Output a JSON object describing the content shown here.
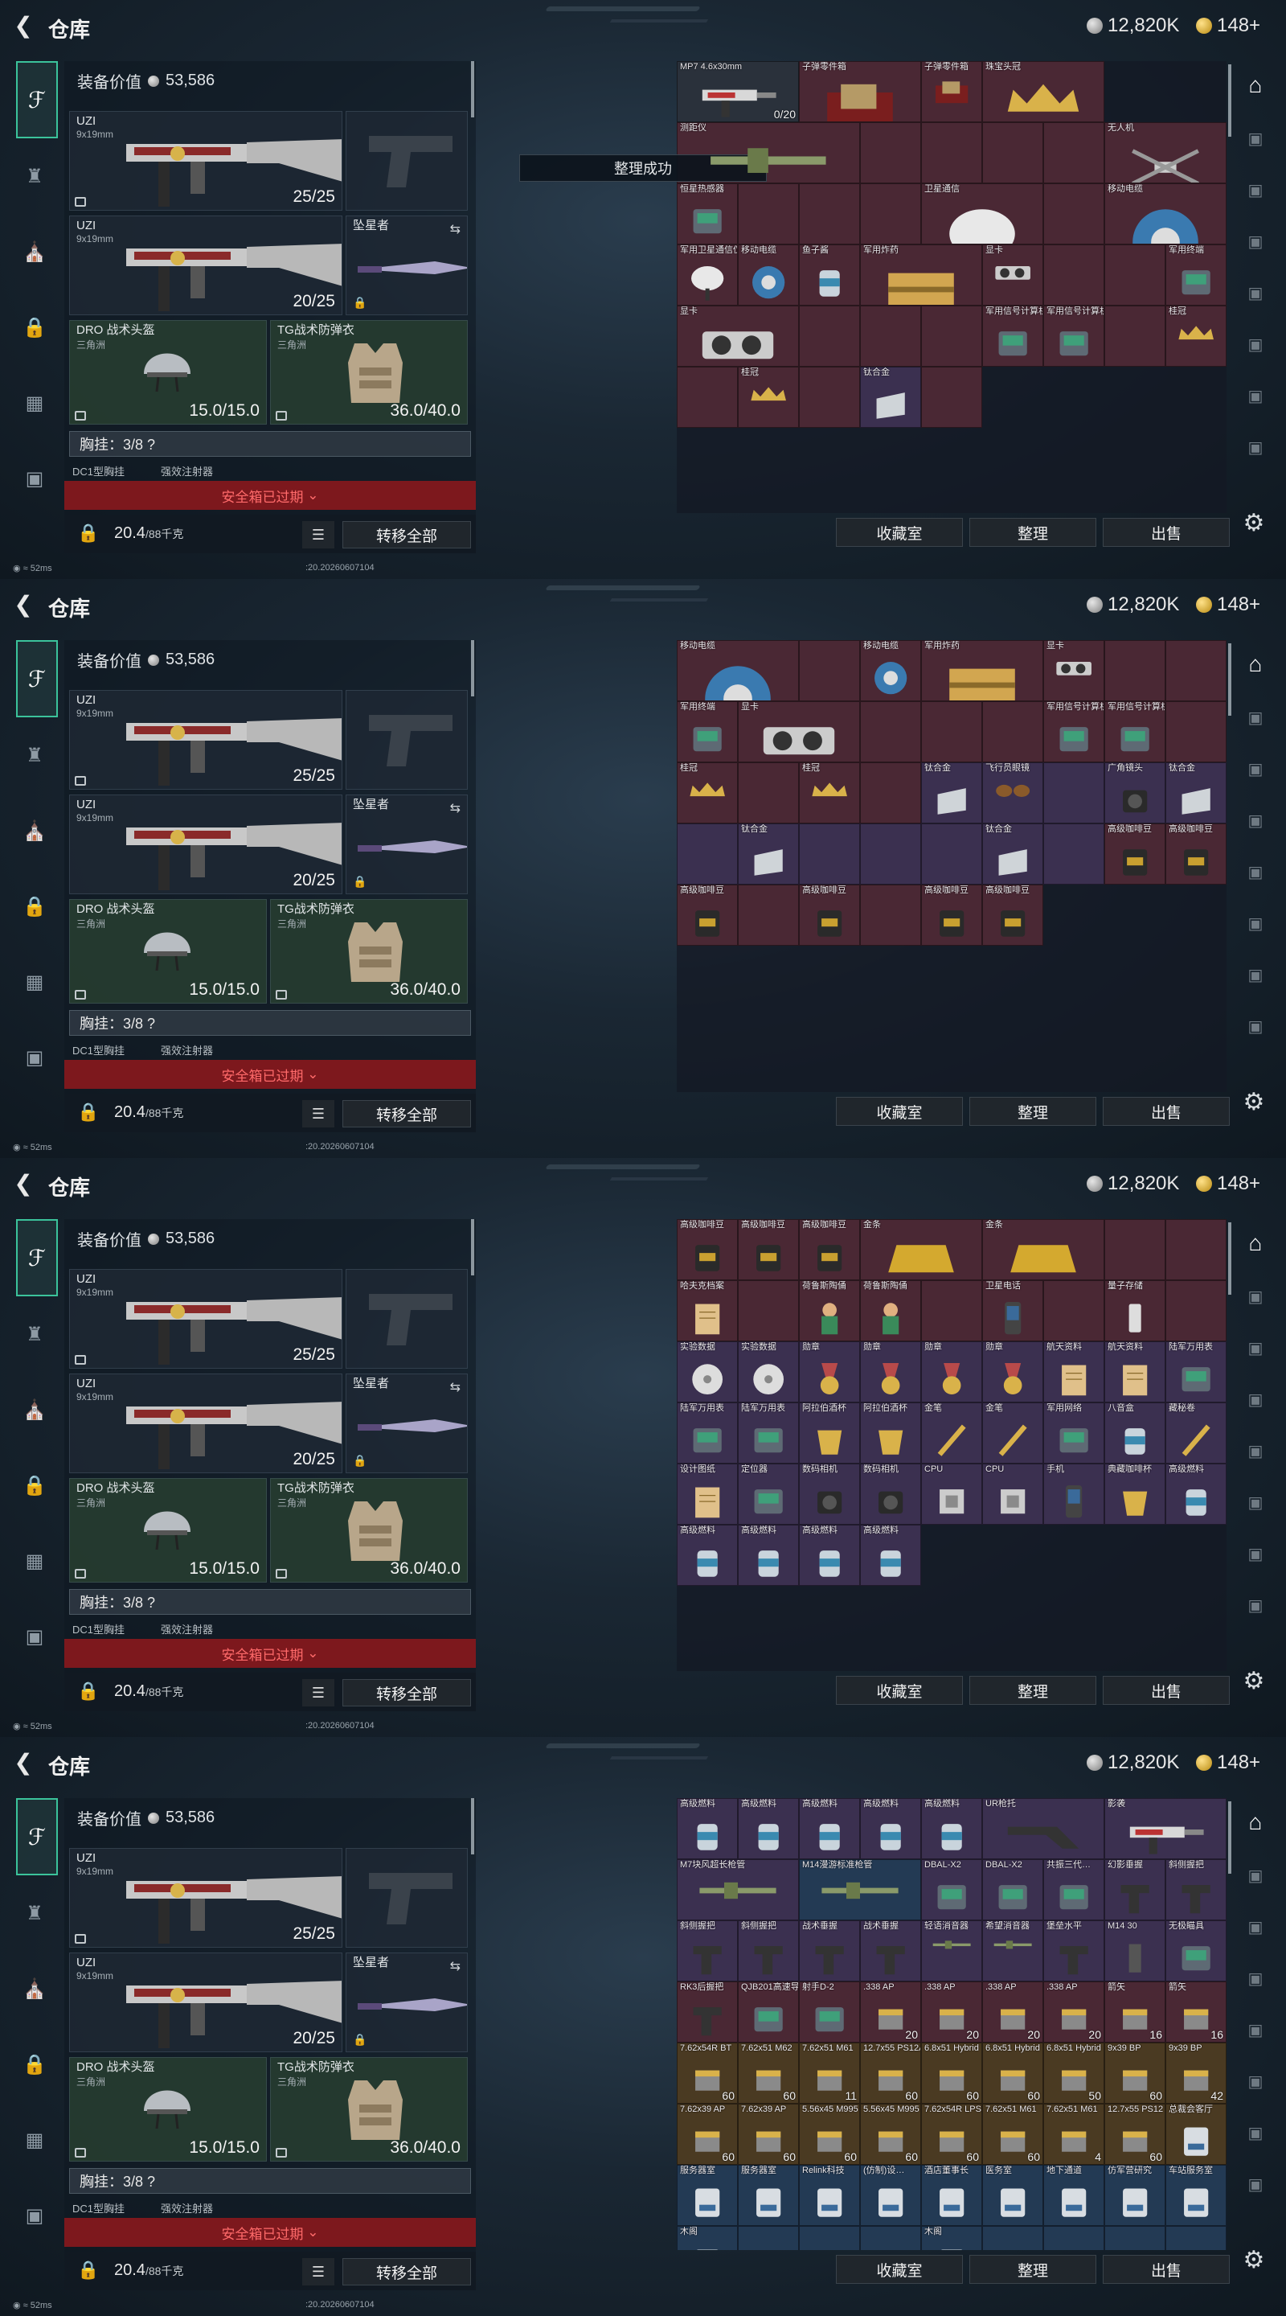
{
  "title": "仓库",
  "currency": {
    "silver": "12,820K",
    "gold": "148+"
  },
  "toast": "整理成功",
  "loadout": {
    "value_label": "装备价值",
    "value": "53,586",
    "primary": {
      "name": "UZI",
      "sub": "9x19mm",
      "count": "25/25"
    },
    "secondary": {
      "name": "UZI",
      "sub": "9x19mm",
      "count": "20/25"
    },
    "melee": {
      "name": "坠星者"
    },
    "helmet": {
      "name": "DRO 战术头盔",
      "sub": "三角洲",
      "count": "15.0/15.0"
    },
    "armor": {
      "name": "TG战术防弹衣",
      "sub": "三角洲",
      "count": "36.0/40.0"
    },
    "chest": "胸挂：3/8  ?",
    "chest_items": [
      "DC1型胸挂",
      "强效注射器"
    ],
    "safe_box": "安全箱已过期",
    "weight": "20.4",
    "weight_unit": "/88千克",
    "transfer_all": "转移全部"
  },
  "stash_buttons": {
    "collection": "收藏室",
    "sort": "整理",
    "sell": "出售"
  },
  "status": {
    "ping": "52ms",
    "build": ":20.20260607104"
  },
  "frames": [
    {
      "cells": [
        {
          "n": "MP7 4.6x30mm",
          "c": "gray",
          "q": "0/20",
          "i": "gun",
          "w": 2,
          "h": 1
        },
        {
          "n": "子弹零件箱",
          "c": "red",
          "i": "box",
          "w": 2,
          "h": 1
        },
        {
          "n": "子弹零件箱",
          "c": "red",
          "i": "box"
        },
        {
          "n": "珠宝头冠",
          "c": "red",
          "i": "crown",
          "w": 2
        },
        {
          "n": "测距仪",
          "c": "red",
          "i": "rod",
          "w": 3
        },
        {
          "n": "",
          "c": "red"
        },
        {
          "n": "",
          "c": "red"
        },
        {
          "n": "",
          "c": "red"
        },
        {
          "n": "",
          "c": "red"
        },
        {
          "n": "无人机",
          "c": "red",
          "i": "drone",
          "w": 2
        },
        {
          "n": "恒星热感器",
          "c": "red",
          "i": "dev"
        },
        {
          "n": "",
          "c": "red"
        },
        {
          "n": "",
          "c": "red"
        },
        {
          "n": "",
          "c": "red"
        },
        {
          "n": "卫星通信",
          "c": "red",
          "i": "dish",
          "w": 2
        },
        {
          "n": "",
          "c": "red"
        },
        {
          "n": "移动电缆",
          "c": "red",
          "i": "reel",
          "w": 2
        },
        {
          "n": "军用卫星通信仪",
          "c": "red",
          "i": "dish"
        },
        {
          "n": "移动电缆",
          "c": "red",
          "i": "reel"
        },
        {
          "n": "鱼子酱",
          "c": "red",
          "i": "can"
        },
        {
          "n": "军用炸药",
          "c": "red",
          "i": "crate",
          "w": 2
        },
        {
          "n": "显卡",
          "c": "red",
          "i": "gpu"
        },
        {
          "n": "",
          "c": "red"
        },
        {
          "n": "",
          "c": "red"
        },
        {
          "n": "军用终端",
          "c": "red",
          "i": "dev"
        },
        {
          "n": "显卡",
          "c": "red",
          "i": "gpu",
          "w": 2
        },
        {
          "n": "",
          "c": "red"
        },
        {
          "n": "",
          "c": "red"
        },
        {
          "n": "",
          "c": "red"
        },
        {
          "n": "军用信号计算机",
          "c": "red",
          "i": "dev"
        },
        {
          "n": "军用信号计算机",
          "c": "red",
          "i": "dev"
        },
        {
          "n": "",
          "c": "red"
        },
        {
          "n": "桂冠",
          "c": "red",
          "i": "crown"
        },
        {
          "n": "",
          "c": "red"
        },
        {
          "n": "桂冠",
          "c": "red",
          "i": "crown"
        },
        {
          "n": "",
          "c": "red"
        },
        {
          "n": "钛合金",
          "c": "purple",
          "i": "bar"
        },
        {
          "n": "",
          "c": "red"
        }
      ]
    },
    {
      "cells": [
        {
          "n": "移动电缆",
          "c": "red",
          "i": "reel",
          "w": 2
        },
        {
          "n": "",
          "c": "red"
        },
        {
          "n": "移动电缆",
          "c": "red",
          "i": "reel"
        },
        {
          "n": "军用炸药",
          "c": "red",
          "i": "crate",
          "w": 2
        },
        {
          "n": "显卡",
          "c": "red",
          "i": "gpu"
        },
        {
          "n": "",
          "c": "red"
        },
        {
          "n": "",
          "c": "red"
        },
        {
          "n": "军用终端",
          "c": "red",
          "i": "dev"
        },
        {
          "n": "显卡",
          "c": "red",
          "i": "gpu",
          "w": 2
        },
        {
          "n": "",
          "c": "red"
        },
        {
          "n": "",
          "c": "red"
        },
        {
          "n": "",
          "c": "red"
        },
        {
          "n": "军用信号计算机",
          "c": "red",
          "i": "dev"
        },
        {
          "n": "军用信号计算机",
          "c": "red",
          "i": "dev"
        },
        {
          "n": "",
          "c": "red"
        },
        {
          "n": "桂冠",
          "c": "red",
          "i": "crown"
        },
        {
          "n": "",
          "c": "red"
        },
        {
          "n": "桂冠",
          "c": "red",
          "i": "crown"
        },
        {
          "n": "",
          "c": "red"
        },
        {
          "n": "钛合金",
          "c": "purple",
          "i": "bar"
        },
        {
          "n": "飞行员眼镜",
          "c": "purple",
          "i": "glasses"
        },
        {
          "n": "",
          "c": "purple"
        },
        {
          "n": "广角镜头",
          "c": "purple",
          "i": "lens"
        },
        {
          "n": "钛合金",
          "c": "purple",
          "i": "bar"
        },
        {
          "n": "",
          "c": "purple"
        },
        {
          "n": "钛合金",
          "c": "purple",
          "i": "bar"
        },
        {
          "n": "",
          "c": "purple"
        },
        {
          "n": "",
          "c": "purple"
        },
        {
          "n": "",
          "c": "purple"
        },
        {
          "n": "钛合金",
          "c": "purple",
          "i": "bar"
        },
        {
          "n": "",
          "c": "purple"
        },
        {
          "n": "高级咖啡豆",
          "c": "red",
          "i": "bag"
        },
        {
          "n": "高级咖啡豆",
          "c": "red",
          "i": "bag"
        },
        {
          "n": "高级咖啡豆",
          "c": "red",
          "i": "bag"
        },
        {
          "n": "",
          "c": "red"
        },
        {
          "n": "高级咖啡豆",
          "c": "red",
          "i": "bag"
        },
        {
          "n": "",
          "c": "red"
        },
        {
          "n": "高级咖啡豆",
          "c": "red",
          "i": "bag"
        },
        {
          "n": "高级咖啡豆",
          "c": "red",
          "i": "bag"
        }
      ]
    },
    {
      "cells": [
        {
          "n": "高级咖啡豆",
          "c": "red",
          "i": "bag"
        },
        {
          "n": "高级咖啡豆",
          "c": "red",
          "i": "bag"
        },
        {
          "n": "高级咖啡豆",
          "c": "red",
          "i": "bag"
        },
        {
          "n": "金条",
          "c": "red",
          "i": "gold",
          "w": 2
        },
        {
          "n": "金条",
          "c": "red",
          "i": "gold",
          "w": 2
        },
        {
          "n": "",
          "c": "red"
        },
        {
          "n": "",
          "c": "red"
        },
        {
          "n": "哈夫克档案",
          "c": "red",
          "i": "doc"
        },
        {
          "n": "",
          "c": "red"
        },
        {
          "n": "荷鲁斯陶俑",
          "c": "red",
          "i": "fig"
        },
        {
          "n": "荷鲁斯陶俑",
          "c": "red",
          "i": "fig"
        },
        {
          "n": "",
          "c": "red"
        },
        {
          "n": "卫星电话",
          "c": "red",
          "i": "phone"
        },
        {
          "n": "",
          "c": "red"
        },
        {
          "n": "量子存储",
          "c": "red",
          "i": "usb"
        },
        {
          "n": "",
          "c": "red"
        },
        {
          "n": "实验数据",
          "c": "purple",
          "i": "disc"
        },
        {
          "n": "实验数据",
          "c": "purple",
          "i": "disc"
        },
        {
          "n": "勋章",
          "c": "purple",
          "i": "medal"
        },
        {
          "n": "勋章",
          "c": "purple",
          "i": "medal"
        },
        {
          "n": "勋章",
          "c": "purple",
          "i": "medal"
        },
        {
          "n": "勋章",
          "c": "purple",
          "i": "medal"
        },
        {
          "n": "航天资料",
          "c": "purple",
          "i": "doc"
        },
        {
          "n": "航天资料",
          "c": "purple",
          "i": "doc"
        },
        {
          "n": "陆军万用表",
          "c": "purple",
          "i": "dev"
        },
        {
          "n": "陆军万用表",
          "c": "purple",
          "i": "dev"
        },
        {
          "n": "陆军万用表",
          "c": "purple",
          "i": "dev"
        },
        {
          "n": "阿拉伯酒杯",
          "c": "purple",
          "i": "cup"
        },
        {
          "n": "阿拉伯酒杯",
          "c": "purple",
          "i": "cup"
        },
        {
          "n": "金笔",
          "c": "purple",
          "i": "pen"
        },
        {
          "n": "金笔",
          "c": "purple",
          "i": "pen"
        },
        {
          "n": "军用网络",
          "c": "purple",
          "i": "dev"
        },
        {
          "n": "八音盒",
          "c": "purple",
          "i": "can"
        },
        {
          "n": "藏秘卷",
          "c": "purple",
          "i": "pen"
        },
        {
          "n": "设计图纸",
          "c": "purple",
          "i": "doc"
        },
        {
          "n": "定位器",
          "c": "purple",
          "i": "dev"
        },
        {
          "n": "数码相机",
          "c": "purple",
          "i": "lens"
        },
        {
          "n": "数码相机",
          "c": "purple",
          "i": "lens"
        },
        {
          "n": "CPU",
          "c": "purple",
          "i": "chip"
        },
        {
          "n": "CPU",
          "c": "purple",
          "i": "chip"
        },
        {
          "n": "手机",
          "c": "purple",
          "i": "phone"
        },
        {
          "n": "典藏咖啡杯",
          "c": "purple",
          "i": "cup"
        },
        {
          "n": "高级燃料",
          "c": "purple",
          "i": "can"
        },
        {
          "n": "高级燃料",
          "c": "purple",
          "i": "can"
        },
        {
          "n": "高级燃料",
          "c": "purple",
          "i": "can"
        },
        {
          "n": "高级燃料",
          "c": "purple",
          "i": "can"
        },
        {
          "n": "高级燃料",
          "c": "purple",
          "i": "can"
        }
      ]
    },
    {
      "cells": [
        {
          "n": "高级燃料",
          "c": "purple",
          "i": "can"
        },
        {
          "n": "高级燃料",
          "c": "purple",
          "i": "can"
        },
        {
          "n": "高级燃料",
          "c": "purple",
          "i": "can"
        },
        {
          "n": "高级燃料",
          "c": "purple",
          "i": "can"
        },
        {
          "n": "高级燃料",
          "c": "purple",
          "i": "can"
        },
        {
          "n": "UR枪托",
          "c": "purple",
          "i": "stock",
          "w": 2
        },
        {
          "n": "影袭",
          "c": "purple",
          "i": "gun",
          "w": 2
        },
        {
          "n": "M7块风超长枪管",
          "c": "purple",
          "i": "rod",
          "w": 2
        },
        {
          "n": "M14漫游标准枪管",
          "c": "blue",
          "i": "rod",
          "w": 2
        },
        {
          "n": "DBAL-X2",
          "c": "purple",
          "i": "dev"
        },
        {
          "n": "DBAL-X2",
          "c": "purple",
          "i": "dev"
        },
        {
          "n": "共振三代…",
          "c": "purple",
          "i": "dev"
        },
        {
          "n": "幻影垂握",
          "c": "purple",
          "i": "grip"
        },
        {
          "n": "斜侧握把",
          "c": "purple",
          "i": "grip"
        },
        {
          "n": "斜侧握把",
          "c": "purple",
          "i": "grip"
        },
        {
          "n": "斜侧握把",
          "c": "purple",
          "i": "grip"
        },
        {
          "n": "战术垂握",
          "c": "purple",
          "i": "grip"
        },
        {
          "n": "战术垂握",
          "c": "purple",
          "i": "grip"
        },
        {
          "n": "轻语消音器",
          "c": "purple",
          "i": "rod"
        },
        {
          "n": "希望消音器",
          "c": "purple",
          "i": "rod"
        },
        {
          "n": "堡垒水平",
          "c": "purple",
          "i": "grip"
        },
        {
          "n": "M14 30",
          "c": "purple",
          "i": "mag"
        },
        {
          "n": "无极瞄具",
          "c": "purple",
          "i": "dev"
        },
        {
          "n": "RK3后握把",
          "c": "red",
          "i": "grip"
        },
        {
          "n": "QJB201高速导气",
          "c": "red",
          "i": "dev"
        },
        {
          "n": "射手D-2",
          "c": "red",
          "i": "dev"
        },
        {
          "n": ".338 AP",
          "c": "red",
          "i": "ammo",
          "q": "20"
        },
        {
          "n": ".338 AP",
          "c": "red",
          "i": "ammo",
          "q": "20"
        },
        {
          "n": ".338 AP",
          "c": "red",
          "i": "ammo",
          "q": "20"
        },
        {
          "n": ".338 AP",
          "c": "red",
          "i": "ammo",
          "q": "20"
        },
        {
          "n": "箭矢",
          "c": "red",
          "i": "ammo",
          "q": "16"
        },
        {
          "n": "箭矢",
          "c": "red",
          "i": "ammo",
          "q": "16"
        },
        {
          "n": "7.62x54R BT",
          "c": "gold",
          "i": "ammo",
          "q": "60"
        },
        {
          "n": "7.62x51 M62",
          "c": "gold",
          "i": "ammo",
          "q": "60"
        },
        {
          "n": "7.62x51 M61",
          "c": "gold",
          "i": "ammo",
          "q": "11"
        },
        {
          "n": "12.7x55 PS12A",
          "c": "gold",
          "i": "ammo",
          "q": "60"
        },
        {
          "n": "6.8x51 Hybrid",
          "c": "gold",
          "i": "ammo",
          "q": "60"
        },
        {
          "n": "6.8x51 Hybrid",
          "c": "gold",
          "i": "ammo",
          "q": "60"
        },
        {
          "n": "6.8x51 Hybrid",
          "c": "gold",
          "i": "ammo",
          "q": "50"
        },
        {
          "n": "9x39 BP",
          "c": "gold",
          "i": "ammo",
          "q": "60"
        },
        {
          "n": "9x39 BP",
          "c": "gold",
          "i": "ammo",
          "q": "42"
        },
        {
          "n": "7.62x39 AP",
          "c": "gold",
          "i": "ammo",
          "q": "60"
        },
        {
          "n": "7.62x39 AP",
          "c": "gold",
          "i": "ammo",
          "q": "60"
        },
        {
          "n": "5.56x45 M995",
          "c": "gold",
          "i": "ammo",
          "q": "60"
        },
        {
          "n": "5.56x45 M995",
          "c": "gold",
          "i": "ammo",
          "q": "60"
        },
        {
          "n": "7.62x54R LPS",
          "c": "gold",
          "i": "ammo",
          "q": "60"
        },
        {
          "n": "7.62x51 M61",
          "c": "gold",
          "i": "ammo",
          "q": "60"
        },
        {
          "n": "7.62x51 M61",
          "c": "gold",
          "i": "ammo",
          "q": "4"
        },
        {
          "n": "12.7x55 PS12",
          "c": "gold",
          "i": "ammo",
          "q": "60"
        },
        {
          "n": "总裁会客厅",
          "c": "gold",
          "i": "card"
        },
        {
          "n": "服务器室",
          "c": "blue",
          "i": "card"
        },
        {
          "n": "服务器室",
          "c": "blue",
          "i": "card"
        },
        {
          "n": "Relink科技",
          "c": "blue",
          "i": "card"
        },
        {
          "n": "(仿制)设…",
          "c": "blue",
          "i": "card"
        },
        {
          "n": "酒店董事长",
          "c": "blue",
          "i": "card"
        },
        {
          "n": "医务室",
          "c": "blue",
          "i": "card"
        },
        {
          "n": "地下通道",
          "c": "blue",
          "i": "card"
        },
        {
          "n": "仿军营研究",
          "c": "blue",
          "i": "card"
        },
        {
          "n": "车站服务室",
          "c": "blue",
          "i": "card"
        },
        {
          "n": "木阁",
          "c": "blue",
          "i": "card"
        },
        {
          "n": "",
          "c": "blue"
        },
        {
          "n": "",
          "c": "blue"
        },
        {
          "n": "",
          "c": "blue"
        },
        {
          "n": "木阁",
          "c": "blue",
          "i": "card"
        },
        {
          "n": "",
          "c": "blue"
        },
        {
          "n": "",
          "c": "blue"
        },
        {
          "n": "",
          "c": "blue"
        },
        {
          "n": "",
          "c": "blue"
        }
      ]
    }
  ]
}
